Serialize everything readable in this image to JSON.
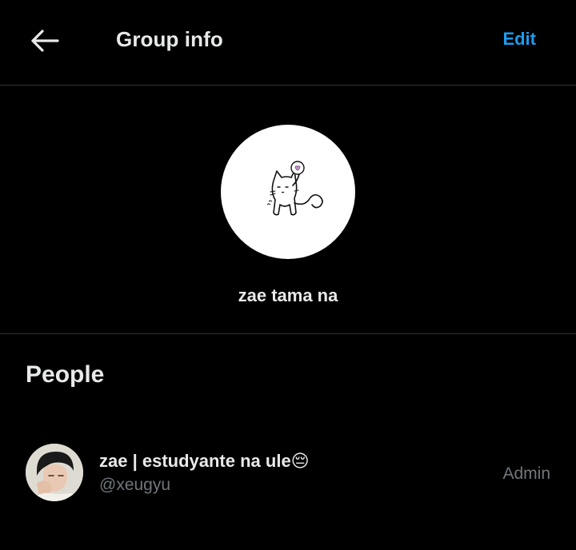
{
  "header": {
    "back_icon": "arrow-left-icon",
    "title": "Group info",
    "edit_label": "Edit"
  },
  "group": {
    "avatar_icon": "cat-doodle-avatar",
    "name": "zae tama na"
  },
  "people": {
    "heading": "People",
    "members": [
      {
        "name": "zae | estudyante na ule😔",
        "handle": "@xeugyu",
        "role": "Admin"
      }
    ]
  },
  "colors": {
    "background": "#000000",
    "text_primary": "#e7e9ea",
    "text_secondary": "#71767b",
    "accent": "#1d9bf0",
    "divider": "#2f3336"
  }
}
